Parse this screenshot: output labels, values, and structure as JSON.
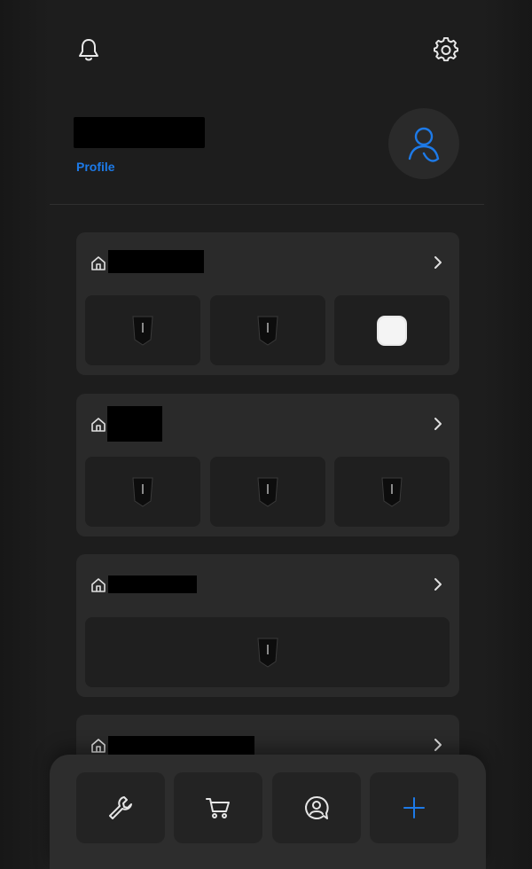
{
  "header": {
    "notifications_icon": "bell-icon",
    "settings_icon": "gear-icon"
  },
  "profile": {
    "link_label": "Profile",
    "avatar_icon": "user-icon",
    "accent_color": "#1d7ae8"
  },
  "sites": [
    {
      "icon": "home-icon",
      "devices": [
        "wallbox-charger",
        "wallbox-charger",
        "white-hub-device"
      ]
    },
    {
      "icon": "home-icon",
      "devices": [
        "wallbox-charger",
        "wallbox-charger",
        "wallbox-charger"
      ]
    },
    {
      "icon": "home-icon",
      "devices": [
        "wallbox-charger"
      ]
    },
    {
      "icon": "home-icon",
      "devices": []
    }
  ],
  "bottom_nav": [
    {
      "icon": "wrench-icon"
    },
    {
      "icon": "cart-icon"
    },
    {
      "icon": "support-chat-icon"
    },
    {
      "icon": "plus-icon",
      "color": "#1d7ae8"
    }
  ]
}
